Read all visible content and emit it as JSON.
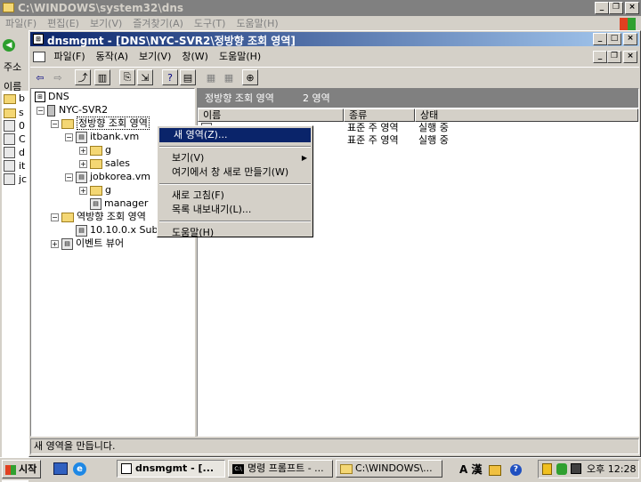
{
  "bg_window": {
    "title": "C:\\WINDOWS\\system32\\dns",
    "menu": [
      "파일(F)",
      "편집(E)",
      "보기(V)",
      "즐겨찾기(A)",
      "도구(T)",
      "도움말(H)"
    ],
    "left_labels": [
      "주소",
      "이름"
    ],
    "left_files": [
      "b",
      "s",
      "0",
      "C",
      "d",
      "it",
      "jc"
    ]
  },
  "mmc": {
    "title": "dnsmgmt - [DNS\\NYC-SVR2\\정방향 조회 영역]",
    "menu": [
      "파일(F)",
      "동작(A)",
      "보기(V)",
      "창(W)",
      "도움말(H)"
    ]
  },
  "tree": {
    "root": "DNS",
    "server": "NYC-SVR2",
    "forward": "정방향 조회 영역",
    "itbank": "itbank.vm",
    "g1": "g",
    "sales": "sales",
    "jobkorea": "jobkorea.vm",
    "g2": "g",
    "manager": "manager",
    "reverse": "역방향 조회 영역",
    "subnet": "10.10.0.x Sub",
    "events": "이벤트 뷰어"
  },
  "right_pane": {
    "header_title": "정방향 조회 영역",
    "header_count": "2 영역",
    "columns": [
      "이름",
      "종류",
      "상태"
    ],
    "rows": [
      {
        "type": "표준 주 영역",
        "status": "실행 중"
      },
      {
        "type": "표준 주 영역",
        "status": "실행 중"
      }
    ]
  },
  "context_menu": {
    "new_zone": "새 영역(Z)...",
    "view": "보기(V)",
    "new_window": "여기에서 창 새로 만들기(W)",
    "refresh": "새로 고침(F)",
    "export": "목록 내보내기(L)...",
    "help": "도움말(H)"
  },
  "status_bar": "새 영역을 만듭니다.",
  "taskbar": {
    "start": "시작",
    "tasks": [
      "dnsmgmt - [...",
      "명령 프롬프트 - ...",
      "C:\\WINDOWS\\..."
    ],
    "ime": "A 漢",
    "clock": "오후 12:28"
  }
}
